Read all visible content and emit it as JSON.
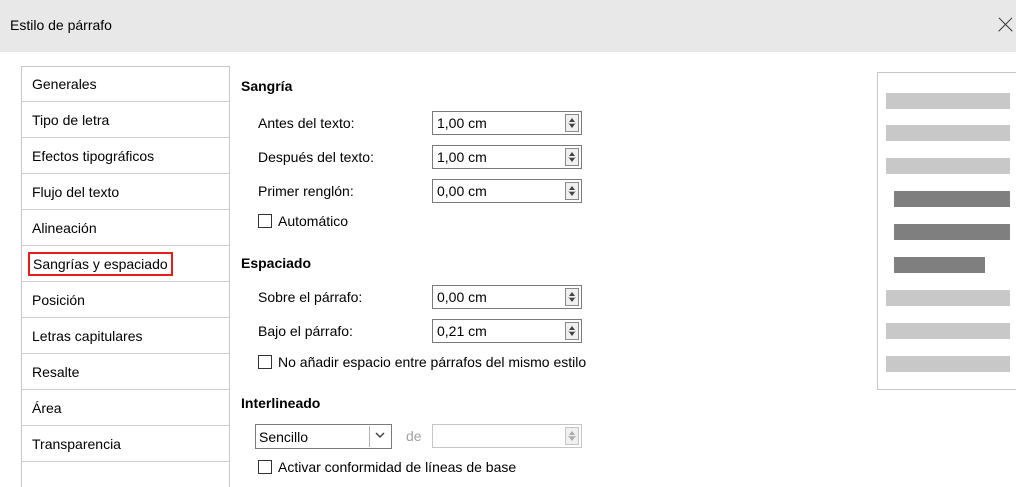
{
  "window": {
    "title": "Estilo de párrafo"
  },
  "tabs": [
    {
      "label": "Generales"
    },
    {
      "label": "Tipo de letra"
    },
    {
      "label": "Efectos tipográficos"
    },
    {
      "label": "Flujo del texto"
    },
    {
      "label": "Alineación"
    },
    {
      "label": "Sangrías y espaciado",
      "active": true
    },
    {
      "label": "Posición"
    },
    {
      "label": "Letras capitulares"
    },
    {
      "label": "Resalte"
    },
    {
      "label": "Área"
    },
    {
      "label": "Transparencia"
    }
  ],
  "indent": {
    "heading": "Sangría",
    "before_label": "Antes del texto:",
    "before_value": "1,00 cm",
    "after_label": "Después del texto:",
    "after_value": "1,00 cm",
    "first_label": "Primer renglón:",
    "first_value": "0,00 cm",
    "auto_label": "Automático"
  },
  "spacing": {
    "heading": "Espaciado",
    "above_label": "Sobre el párrafo:",
    "above_value": "0,00 cm",
    "below_label": "Bajo el párrafo:",
    "below_value": "0,21 cm",
    "no_space_label": "No añadir espacio entre párrafos del mismo estilo"
  },
  "line_spacing": {
    "heading": "Interlineado",
    "selected": "Sencillo",
    "of_label": "de",
    "baseline_label": "Activar conformidad de líneas de base"
  },
  "colors": {
    "highlight": "#e81c1c",
    "preview_light": "#c8c8c8",
    "preview_dark": "#7f7f7f"
  }
}
